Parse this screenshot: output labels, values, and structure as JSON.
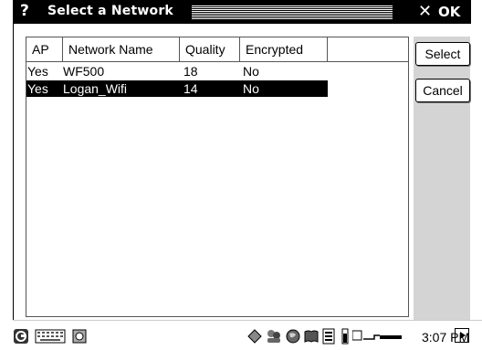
{
  "window": {
    "title_icon": "question-icon",
    "title": "Select a Network",
    "close_glyph": "✕",
    "ok_label": "OK"
  },
  "list": {
    "columns": [
      "AP",
      "Network Name",
      "Quality",
      "Encrypted"
    ],
    "rows": [
      {
        "ap": "Yes",
        "name": "WF500",
        "quality": "18",
        "encrypted": "No",
        "selected": false
      },
      {
        "ap": "Yes",
        "name": "Logan_Wifi",
        "quality": "14",
        "encrypted": "No",
        "selected": true
      }
    ]
  },
  "buttons": {
    "select": "Select",
    "cancel": "Cancel"
  },
  "taskbar": {
    "icons": [
      "start-icon",
      "keyboard-icon",
      "app-icon",
      "network-icon",
      "people-icon",
      "globe-icon",
      "book-icon",
      "contacts-icon",
      "battery-icon",
      "power-icon"
    ],
    "clock": "3:07 PM"
  },
  "colors": {
    "selection": "#000000",
    "panel": "#d4d4d4"
  }
}
